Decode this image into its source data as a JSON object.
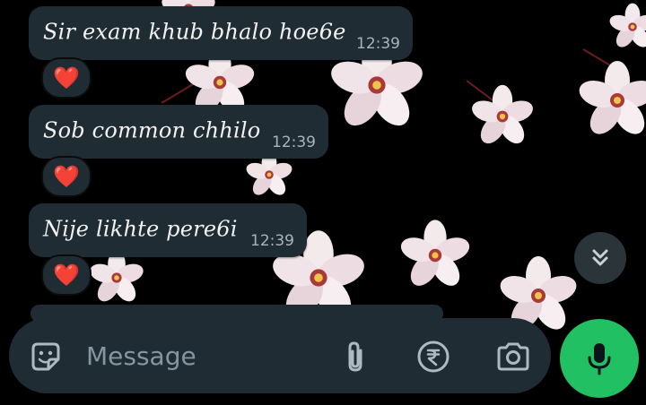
{
  "messages": [
    {
      "text": "Sir exam khub bhalo hoe6e",
      "time": "12:39",
      "reaction": "❤️"
    },
    {
      "text": "Sob common chhilo",
      "time": "12:39",
      "reaction": "❤️"
    },
    {
      "text": "Nije likhte pere6i",
      "time": "12:39",
      "reaction": "❤️"
    }
  ],
  "composer": {
    "placeholder": "Message"
  },
  "icons": {
    "sticker": "sticker-icon",
    "attach": "paperclip-icon",
    "payment": "rupee-icon",
    "camera": "camera-icon",
    "mic": "microphone-icon",
    "scroll": "double-chevron-down-icon"
  },
  "colors": {
    "bubble": "#202c33",
    "accent": "#21c063",
    "heart": "#e0245e"
  }
}
